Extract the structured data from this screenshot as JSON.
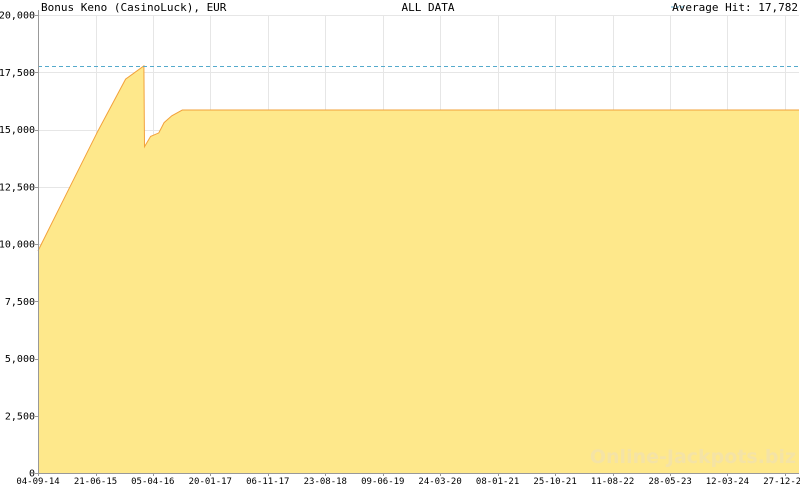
{
  "header": {
    "title": "Bonus Keno (CasinoLuck), EUR",
    "range_label": "ALL DATA",
    "average_label": "Average Hit: 17,782"
  },
  "watermark": "Online-Jackpots.biz",
  "colors": {
    "fill": "#fee88b",
    "line": "#f2a13a",
    "average": "#55aacc",
    "grid": "#e6e6e6",
    "axis": "#999999",
    "watermark": "#f4e3a6"
  },
  "chart_data": {
    "type": "area",
    "title": "Bonus Keno (CasinoLuck), EUR",
    "xlabel": "",
    "ylabel": "",
    "ylim": [
      0,
      20000
    ],
    "xlim": [
      "2014-09-04",
      "2025-03-08"
    ],
    "grid": true,
    "yticks": [
      0,
      2500,
      5000,
      7500,
      10000,
      12500,
      15000,
      17500,
      20000
    ],
    "ytick_labels": [
      "0",
      "2,500",
      "5,000",
      "7,500",
      "10,000",
      "12,500",
      "15,000",
      "17,500",
      "20,000"
    ],
    "xticks": [
      "2014-09-04",
      "2015-06-21",
      "2016-04-05",
      "2017-01-20",
      "2017-11-06",
      "2018-08-23",
      "2019-06-09",
      "2020-03-24",
      "2021-01-08",
      "2021-10-25",
      "2022-08-11",
      "2023-05-28",
      "2024-03-12",
      "2024-12-27"
    ],
    "xtick_labels": [
      "04-09-14",
      "21-06-15",
      "05-04-16",
      "20-01-17",
      "06-11-17",
      "23-08-18",
      "09-06-19",
      "24-03-20",
      "08-01-21",
      "25-10-21",
      "11-08-22",
      "28-05-23",
      "12-03-24",
      "27-12-24"
    ],
    "average_hit": 17782,
    "series": [
      {
        "points": [
          [
            "2014-09-04",
            9700
          ],
          [
            "2015-02-01",
            12300
          ],
          [
            "2015-07-01",
            14900
          ],
          [
            "2015-11-20",
            17200
          ],
          [
            "2016-02-20",
            17782
          ],
          [
            "2016-02-23",
            14250
          ],
          [
            "2016-03-25",
            14700
          ],
          [
            "2016-05-05",
            14850
          ],
          [
            "2016-06-01",
            15300
          ],
          [
            "2016-07-10",
            15600
          ],
          [
            "2016-09-01",
            15850
          ],
          [
            "2017-06-01",
            15850
          ],
          [
            "2020-01-01",
            15850
          ],
          [
            "2025-03-08",
            15850
          ]
        ]
      }
    ]
  }
}
